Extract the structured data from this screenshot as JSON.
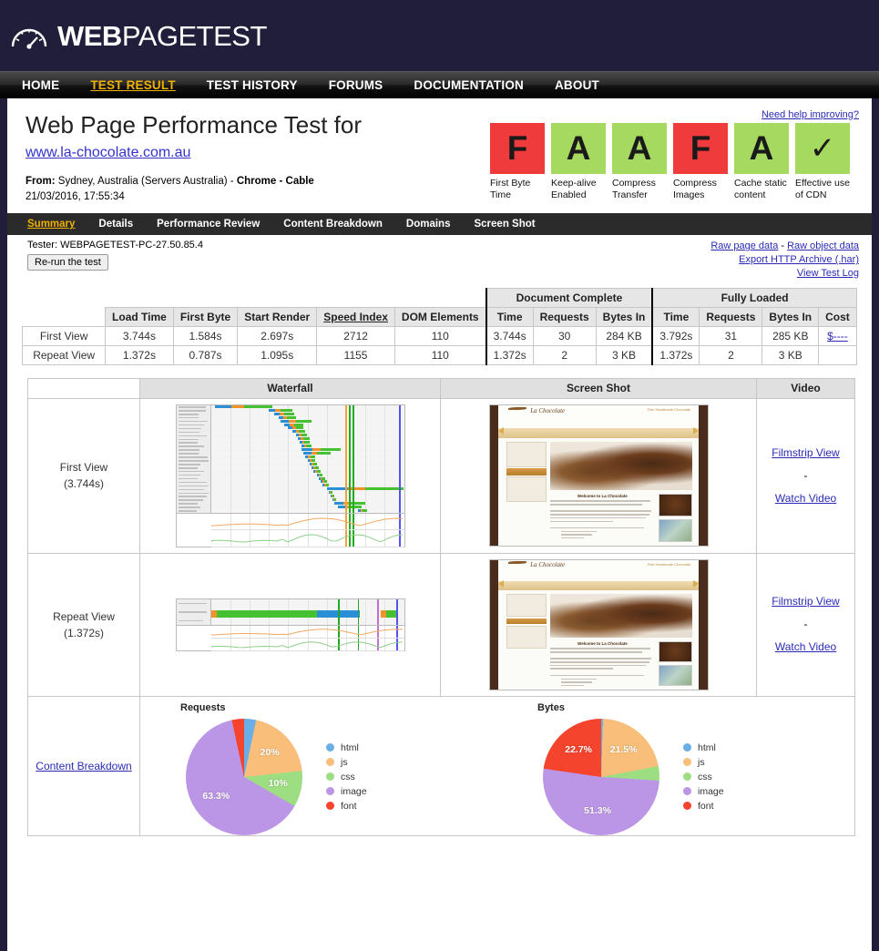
{
  "brand": {
    "logo_web": "WEB",
    "logo_page": "PAGE",
    "logo_test": "TEST",
    "logo_icon": "speed-gauge-icon",
    "navy": "#211e3b",
    "accent": "#f0b100"
  },
  "nav": {
    "items": [
      {
        "label": "HOME",
        "active": false
      },
      {
        "label": "TEST RESULT",
        "active": true
      },
      {
        "label": "TEST HISTORY",
        "active": false
      },
      {
        "label": "FORUMS",
        "active": false
      },
      {
        "label": "DOCUMENTATION",
        "active": false
      },
      {
        "label": "ABOUT",
        "active": false
      }
    ]
  },
  "header": {
    "title": "Web Page Performance Test for",
    "url": "www.la-chocolate.com.au",
    "from_label": "From:",
    "from_value": "Sydney, Australia (Servers Australia) -",
    "browser": "Chrome",
    "separator": "-",
    "connection": "Cable",
    "timestamp": "21/03/2016, 17:55:34",
    "help_link": "Need help improving?"
  },
  "grades": [
    {
      "grade": "F",
      "color": "red",
      "label": "First Byte Time"
    },
    {
      "grade": "A",
      "color": "green",
      "label": "Keep-alive Enabled"
    },
    {
      "grade": "A",
      "color": "green",
      "label": "Compress Transfer"
    },
    {
      "grade": "F",
      "color": "red",
      "label": "Compress Images"
    },
    {
      "grade": "A",
      "color": "green",
      "label": "Cache static content"
    },
    {
      "grade": "✓",
      "color": "green",
      "label": "Effective use of CDN"
    }
  ],
  "tabs": [
    {
      "label": "Summary",
      "active": true
    },
    {
      "label": "Details",
      "active": false
    },
    {
      "label": "Performance Review",
      "active": false
    },
    {
      "label": "Content Breakdown",
      "active": false
    },
    {
      "label": "Domains",
      "active": false
    },
    {
      "label": "Screen Shot",
      "active": false
    }
  ],
  "tester": {
    "text": "Tester: WEBPAGETEST-PC-27.50.85.4",
    "rerun_label": "Re-run the test",
    "links": {
      "raw_page": "Raw page data",
      "dash": "-",
      "raw_object": "Raw object data",
      "export_har": "Export HTTP Archive (.har)",
      "view_log": "View Test Log"
    }
  },
  "metrics": {
    "group_headers": {
      "document_complete": "Document Complete",
      "fully_loaded": "Fully Loaded"
    },
    "columns": [
      "Load Time",
      "First Byte",
      "Start Render",
      "Speed Index",
      "DOM Elements",
      "Time",
      "Requests",
      "Bytes In",
      "Time",
      "Requests",
      "Bytes In",
      "Cost"
    ],
    "rows": [
      {
        "name": "First View",
        "load_time": "3.744s",
        "first_byte": "1.584s",
        "start_render": "2.697s",
        "speed_index": "2712",
        "dom_elements": "110",
        "dc_time": "3.744s",
        "dc_requests": "30",
        "dc_bytes": "284 KB",
        "fl_time": "3.792s",
        "fl_requests": "31",
        "fl_bytes": "285 KB",
        "cost": "$----"
      },
      {
        "name": "Repeat View",
        "load_time": "1.372s",
        "first_byte": "0.787s",
        "start_render": "1.095s",
        "speed_index": "1155",
        "dom_elements": "110",
        "dc_time": "1.372s",
        "dc_requests": "2",
        "dc_bytes": "3 KB",
        "fl_time": "1.372s",
        "fl_requests": "2",
        "fl_bytes": "3 KB",
        "cost": ""
      }
    ]
  },
  "results_table": {
    "headers": {
      "blank": "",
      "waterfall": "Waterfall",
      "screenshot": "Screen Shot",
      "video": "Video"
    },
    "rows": [
      {
        "view": "First View",
        "time": "(3.744s)",
        "filmstrip": "Filmstrip View",
        "dash": "-",
        "watch": "Watch Video"
      },
      {
        "view": "Repeat View",
        "time": "(1.372s)",
        "filmstrip": "Filmstrip View",
        "dash": "-",
        "watch": "Watch Video"
      }
    ],
    "content_breakdown_label": "Content Breakdown"
  },
  "site_preview": {
    "brand": "La Chocolate",
    "tagline": "Fine Handmade Chocolate",
    "heading": "Welcome to La Chocolate"
  },
  "chart_data": [
    {
      "type": "pie",
      "title": "Requests",
      "labels": [
        "html",
        "js",
        "css",
        "image",
        "font"
      ],
      "values": [
        3.3,
        20.0,
        10.0,
        63.3,
        3.3
      ],
      "display_labels": [
        "",
        "20%",
        "10%",
        "63.3%",
        ""
      ],
      "colors": [
        "#6aaee8",
        "#f9bf7a",
        "#9ede82",
        "#bc96e6",
        "#f5442e"
      ],
      "legend_position": "right"
    },
    {
      "type": "pie",
      "title": "Bytes",
      "labels": [
        "html",
        "js",
        "css",
        "image",
        "font"
      ],
      "values": [
        0.5,
        21.5,
        4.0,
        51.3,
        22.7
      ],
      "display_labels": [
        "",
        "21.5%",
        "",
        "51.3%",
        "22.7%"
      ],
      "colors": [
        "#6aaee8",
        "#f9bf7a",
        "#9ede82",
        "#bc96e6",
        "#f5442e"
      ],
      "legend_position": "right"
    }
  ]
}
